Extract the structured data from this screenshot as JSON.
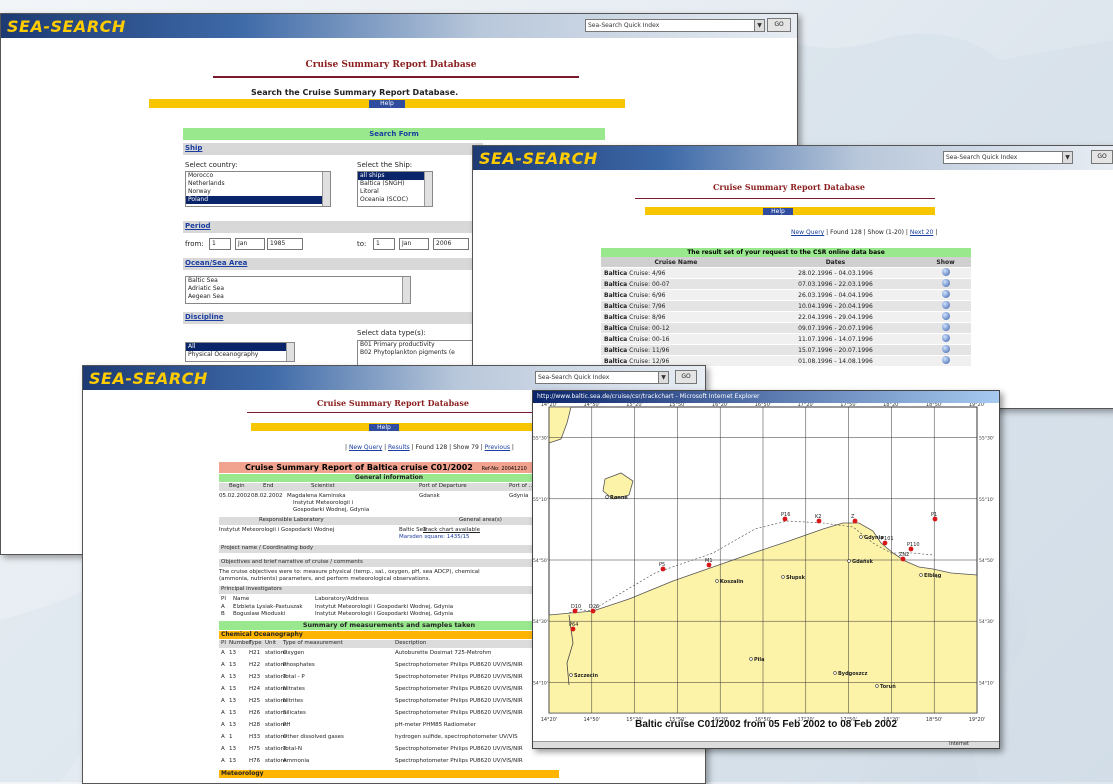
{
  "app": {
    "logo": "SEA-SEARCH",
    "quick_index": "Sea-Search Quick Index",
    "go": "GO"
  },
  "db_title": "Cruise Summary Report Database",
  "help": "Help",
  "search": {
    "heading": "Search the Cruise Summary Report Database.",
    "form_title": "Search Form",
    "ship": {
      "label": "Ship",
      "country_label": "Select country:",
      "countries": [
        "Morocco",
        "Netherlands",
        "Norway",
        "Poland"
      ],
      "ship_label": "Select the Ship:",
      "ships": [
        "all ships",
        "Baltica (SNGH)",
        "Litoral",
        "Oceania (SCOC)"
      ]
    },
    "period": {
      "label": "Period",
      "from_label": "from:",
      "to_label": "to:",
      "from": {
        "day": "1",
        "month": "Jan",
        "year": "1985"
      },
      "to": {
        "day": "1",
        "month": "Jan",
        "year": "2006"
      }
    },
    "ocean": {
      "label": "Ocean/Sea Area",
      "items": [
        "Baltic Sea",
        "Adriatic Sea",
        "Aegean Sea"
      ]
    },
    "discipline": {
      "label": "Discipline",
      "items": [
        "All",
        "Physical Oceanography"
      ],
      "datatype_label": "Select data type(s):",
      "datatypes": [
        "B01 Primary productivity",
        "B02 Phytoplankton pigments (e"
      ]
    }
  },
  "results": {
    "nav": {
      "new_query": "New Query",
      "found": "Found 128",
      "show": "Show (1-20)",
      "next": "Next 20"
    },
    "banner": "The result set of your request to the CSR online data base",
    "headers": [
      "Cruise Name",
      "Dates",
      "Show"
    ],
    "rows": [
      {
        "ship": "Baltica",
        "cruise": "Cruise: 4/96",
        "dates": "28.02.1996 - 04.03.1996"
      },
      {
        "ship": "Baltica",
        "cruise": "Cruise: 00-07",
        "dates": "07.03.1996 - 22.03.1996"
      },
      {
        "ship": "Baltica",
        "cruise": "Cruise: 6/96",
        "dates": "26.03.1996 - 04.04.1996"
      },
      {
        "ship": "Baltica",
        "cruise": "Cruise: 7/96",
        "dates": "10.04.1996 - 20.04.1996"
      },
      {
        "ship": "Baltica",
        "cruise": "Cruise: 8/96",
        "dates": "22.04.1996 - 29.04.1996"
      },
      {
        "ship": "Baltica",
        "cruise": "Cruise: 00-12",
        "dates": "09.07.1996 - 20.07.1996"
      },
      {
        "ship": "Baltica",
        "cruise": "Cruise: 00-16",
        "dates": "11.07.1996 - 14.07.1996"
      },
      {
        "ship": "Baltica",
        "cruise": "Cruise: 11/96",
        "dates": "15.07.1996 - 20.07.1996"
      },
      {
        "ship": "Baltica",
        "cruise": "Cruise: 12/96",
        "dates": "01.08.1996 - 14.08.1996"
      }
    ]
  },
  "detail": {
    "nav": {
      "new_query": "New Query",
      "results": "Results",
      "found": "Found 128",
      "show": "Show 79",
      "previous": "Previous"
    },
    "report_title": "Cruise Summary Report of Baltica cruise C01/2002",
    "report_ref": "Ref-No: 20041210",
    "general_info": "General information",
    "cols": [
      "Begin",
      "End",
      "Scientist",
      "Port of Departure",
      "Port of ..."
    ],
    "row": {
      "begin": "05.02.2002",
      "end": "08.02.2002",
      "scientist": "Magdalena Kaminska",
      "institute": "Instytut Meteorologii i",
      "institute2": "Gospodarki Wodnej, Gdynia",
      "port_dep": "Gdansk",
      "port_arr": "Gdynia"
    },
    "lab_label": "Responsible Laboratory",
    "lab": "Instytut Meteorologii i Gospodarki Wodnej",
    "area_label": "General area(s)",
    "area": "Baltic Sea",
    "track_chart": "Track chart available",
    "marsden": "Marsden square: 1435/15",
    "project": "Project name / Coordinating body",
    "objectives_label": "Objectives and brief narrative of cruise / comments",
    "objectives": "The cruise objectives were to: measure physical (temp., sal., oxygen, pH, sea ADCP), chemical",
    "objectives2": "(ammonia, nutrients) parameters, and perform meteorological observations.",
    "pi_label": "Principal investigators",
    "pi_cols": [
      "PI",
      "Name",
      "Laboratory/Address"
    ],
    "pis": [
      {
        "pi": "A",
        "name": "Elzbieta Lysiak-Pastuszak",
        "lab": "Instytut Meteorologii i Gospodarki Wodnej, Gdynia"
      },
      {
        "pi": "B",
        "name": "Boguslaw Mioduski",
        "lab": "Instytut Meteorologii i Gospodarki Wodnej, Gdynia"
      }
    ],
    "summary": "Summary of measurements and samples taken",
    "chem": "Chemical Oceanography",
    "meas_cols": [
      "PI",
      "Number",
      "Type",
      "Unit",
      "Type of measurement",
      "Description"
    ],
    "meas": [
      {
        "pi": "A",
        "num": "13",
        "type": "H21",
        "unit": "stations",
        "name": "Oxygen",
        "desc": "Autoburette Dosimat 725-Metrohm"
      },
      {
        "pi": "A",
        "num": "13",
        "type": "H22",
        "unit": "stations",
        "name": "Phosphates",
        "desc": "Spectrophotometer Philips PU8620 UV/VIS/NIR"
      },
      {
        "pi": "A",
        "num": "13",
        "type": "H23",
        "unit": "stations",
        "name": "Total - P",
        "desc": "Spectrophotometer Philips PU8620 UV/VIS/NIR"
      },
      {
        "pi": "A",
        "num": "13",
        "type": "H24",
        "unit": "stations",
        "name": "Nitrates",
        "desc": "Spectrophotometer Philips PU8620 UV/VIS/NIR"
      },
      {
        "pi": "A",
        "num": "13",
        "type": "H25",
        "unit": "stations",
        "name": "Nitrites",
        "desc": "Spectrophotometer Philips PU8620 UV/VIS/NIR"
      },
      {
        "pi": "A",
        "num": "13",
        "type": "H26",
        "unit": "stations",
        "name": "Silicates",
        "desc": "Spectrophotometer Philips PU8620 UV/VIS/NIR"
      },
      {
        "pi": "A",
        "num": "13",
        "type": "H28",
        "unit": "stations",
        "name": "PH",
        "desc": "pH-meter PHM85 Radiometer"
      },
      {
        "pi": "A",
        "num": "1",
        "type": "H33",
        "unit": "stations",
        "name": "Other dissolved gases",
        "desc": "hydrogen sulfide, spectrophotometer UV/VIS"
      },
      {
        "pi": "A",
        "num": "13",
        "type": "H75",
        "unit": "stations",
        "name": "Total-N",
        "desc": "Spectrophotometer Philips PU8620 UV/VIS/NIR"
      },
      {
        "pi": "A",
        "num": "13",
        "type": "H76",
        "unit": "stations",
        "name": "Ammonia",
        "desc": "Spectrophotometer Philips PU8620 UV/VIS/NIR"
      }
    ],
    "meteo": "Meteorology"
  },
  "map": {
    "window_title": "http://www.baltic.sea.de/cruise/csr/trackchart - Microsoft Internet Explorer",
    "caption": "Baltic cruise C01/2002 from 05 Feb 2002 to 08 Feb 2002",
    "status": "Internet",
    "lon_ticks": [
      "14°20'",
      "14°50'",
      "15°20'",
      "15°50'",
      "16°20'",
      "16°50'",
      "17°20'",
      "17°50'",
      "18°20'",
      "18°50'",
      "19°20'"
    ],
    "lat_ticks": [
      "55°30'",
      "55°10'",
      "54°50'",
      "54°30'",
      "54°10'"
    ],
    "towns": [
      "Rønne",
      "Słupsk",
      "Koszalin",
      "Gdynia",
      "Gdańsk",
      "Elbląg",
      "Szczecin",
      "Pila",
      "Bydgoszcz",
      "Toruń"
    ],
    "stations": [
      "P16",
      "K2",
      "Z",
      "P101",
      "P1",
      "P110",
      "ZN2",
      "P5",
      "M1",
      "D10",
      "D26",
      "P64"
    ],
    "colors": {
      "sea": "#ffffff",
      "land": "#fdf3a8",
      "station": "#d81818"
    }
  }
}
